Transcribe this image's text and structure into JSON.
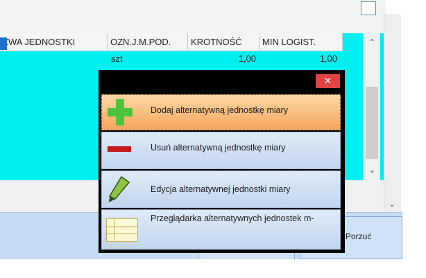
{
  "grid": {
    "headers": [
      "ZWA JEDNOSTKI",
      "OZN.J.M.POD.",
      "KROTNOŚĆ",
      "MIN LOGIST."
    ],
    "row": {
      "unit": "szt",
      "krotnosc": "1,00",
      "min_logist": "1,00"
    }
  },
  "popup": {
    "close_label": "✕",
    "items": [
      {
        "label": "Dodaj alternatywną jednostkę miary",
        "icon": "plus-icon"
      },
      {
        "label": "Usuń alternatywną jednostkę miary",
        "icon": "minus-icon"
      },
      {
        "label": "Edycja alternatywnej jednostki miary",
        "icon": "highlighter-icon"
      },
      {
        "label": "Przeglądarka alternatywnych jednostek m-",
        "icon": "table-icon"
      }
    ]
  },
  "buttons": {
    "porzuc": "Porzuć"
  },
  "colors": {
    "grid_bg": "#00f0f0",
    "active_item": "#f4a65b",
    "close_red": "#e04343",
    "plus_green": "#4cc33a",
    "minus_red": "#c41b1b"
  }
}
